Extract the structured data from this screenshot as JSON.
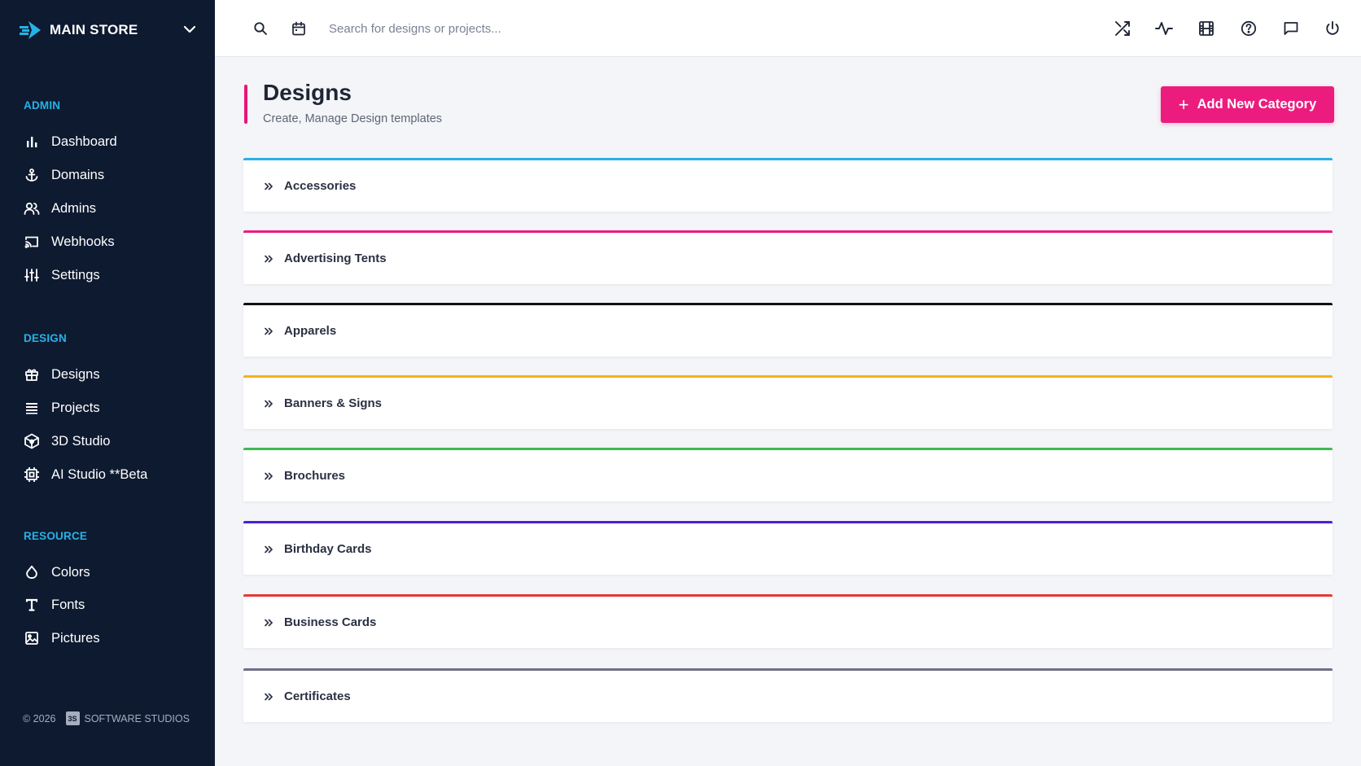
{
  "brand": {
    "name": "MAIN STORE",
    "logo_icon": "arrow-logo-icon",
    "accent_color": "#27b2e6"
  },
  "sidebar": {
    "sections": [
      {
        "label": "ADMIN",
        "items": [
          {
            "label": "Dashboard",
            "icon": "bar-chart-icon"
          },
          {
            "label": "Domains",
            "icon": "anchor-icon"
          },
          {
            "label": "Admins",
            "icon": "users-icon"
          },
          {
            "label": "Webhooks",
            "icon": "cast-icon"
          },
          {
            "label": "Settings",
            "icon": "sliders-icon"
          }
        ]
      },
      {
        "label": "DESIGN",
        "items": [
          {
            "label": "Designs",
            "icon": "gift-icon"
          },
          {
            "label": "Projects",
            "icon": "list-icon"
          },
          {
            "label": "3D Studio",
            "icon": "cube-icon"
          },
          {
            "label": "AI Studio **Beta",
            "icon": "chip-icon"
          }
        ]
      },
      {
        "label": "RESOURCE",
        "items": [
          {
            "label": "Colors",
            "icon": "droplet-icon"
          },
          {
            "label": "Fonts",
            "icon": "type-icon"
          },
          {
            "label": "Pictures",
            "icon": "image-icon"
          }
        ]
      }
    ],
    "footer": {
      "copyright": "© 2026",
      "logo_text": "3S",
      "company": "SOFTWARE STUDIOS"
    }
  },
  "topbar": {
    "search_placeholder": "Search for designs or projects...",
    "left_icons": [
      "search-icon",
      "calendar-icon"
    ],
    "right_icons": [
      "shuffle-icon",
      "activity-icon",
      "film-icon",
      "help-circle-icon",
      "message-square-icon",
      "power-icon"
    ]
  },
  "page": {
    "title": "Designs",
    "subtitle": "Create, Manage Design templates",
    "accent_color": "#e9157a",
    "add_button_label": "Add New Category",
    "add_button_color": "#ec1c7f"
  },
  "categories": [
    {
      "label": "Accessories",
      "color": "#27b2e6"
    },
    {
      "label": "Advertising Tents",
      "color": "#ec1c7f"
    },
    {
      "label": "Apparels",
      "color": "#111111"
    },
    {
      "label": "Banners & Signs",
      "color": "#f5b21c"
    },
    {
      "label": "Brochures",
      "color": "#3fb950"
    },
    {
      "label": "Birthday Cards",
      "color": "#4b1fd6"
    },
    {
      "label": "Business Cards",
      "color": "#e53935"
    },
    {
      "label": "Certificates",
      "color": "#6e6f88"
    }
  ]
}
